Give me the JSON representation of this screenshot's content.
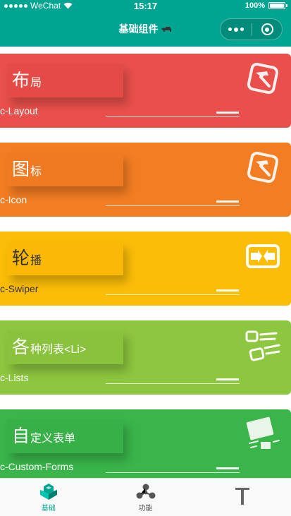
{
  "status": {
    "carrier": "WeChat",
    "time": "15:17",
    "battery": "100%"
  },
  "nav": {
    "title": "基础组件"
  },
  "cards": [
    {
      "big": "布",
      "small": "局",
      "sub": "c-Layout",
      "color": "#e9504b",
      "icon": "hammer-icon"
    },
    {
      "big": "图",
      "small": "标",
      "sub": "c-Icon",
      "color": "#f37d23",
      "icon": "hammer-icon"
    },
    {
      "big": "轮",
      "small": "播",
      "sub": "c-Swiper",
      "color": "#fbbd08",
      "icon": "swiper-icon"
    },
    {
      "big": "各",
      "small": "种列表<Li>",
      "sub": "c-Lists",
      "color": "#8dc63f",
      "icon": "list-icon"
    },
    {
      "big": "自",
      "small": "定义表单",
      "sub": "c-Custom-Forms",
      "color": "#39b54a",
      "icon": "form-icon"
    }
  ],
  "tabs": [
    {
      "label": "基础",
      "icon": "cube-icon",
      "active": true
    },
    {
      "label": "功能",
      "icon": "network-icon",
      "active": false
    },
    {
      "label": "",
      "icon": "text-t-icon",
      "active": false
    }
  ],
  "theme": {
    "primary": "#00a591"
  }
}
